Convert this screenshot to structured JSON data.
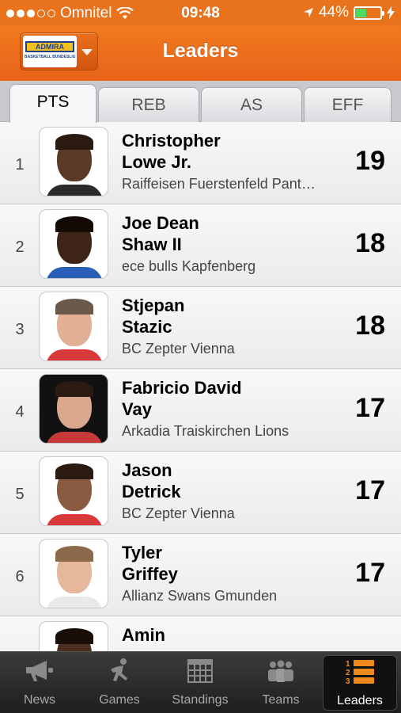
{
  "status": {
    "carrier": "Omnitel",
    "time": "09:48",
    "battery": "44%"
  },
  "header": {
    "title": "Leaders",
    "logo_text": "ADMIRA",
    "logo_sub": "BASKETBALL BUNDESLIGA"
  },
  "tabs": [
    {
      "label": "PTS",
      "active": true
    },
    {
      "label": "REB",
      "active": false
    },
    {
      "label": "AS",
      "active": false
    },
    {
      "label": "EFF",
      "active": false
    }
  ],
  "leaders": [
    {
      "rank": "1",
      "name_line1": "Christopher",
      "name_line2": "Lowe Jr.",
      "team": "Raiffeisen Fuerstenfeld Panthers",
      "value": "19"
    },
    {
      "rank": "2",
      "name_line1": "Joe Dean",
      "name_line2": "Shaw II",
      "team": "ece bulls Kapfenberg",
      "value": "18"
    },
    {
      "rank": "3",
      "name_line1": "Stjepan",
      "name_line2": "Stazic",
      "team": "BC Zepter Vienna",
      "value": "18"
    },
    {
      "rank": "4",
      "name_line1": "Fabricio David",
      "name_line2": "Vay",
      "team": "Arkadia Traiskirchen Lions",
      "value": "17"
    },
    {
      "rank": "5",
      "name_line1": "Jason",
      "name_line2": "Detrick",
      "team": "BC Zepter Vienna",
      "value": "17"
    },
    {
      "rank": "6",
      "name_line1": "Tyler",
      "name_line2": "Griffey",
      "team": "Allianz Swans Gmunden",
      "value": "17"
    },
    {
      "rank": "",
      "name_line1": "Amin",
      "name_line2": "",
      "team": "",
      "value": ""
    }
  ],
  "nav": [
    {
      "label": "News",
      "icon": "megaphone-icon",
      "active": false
    },
    {
      "label": "Games",
      "icon": "runner-icon",
      "active": false
    },
    {
      "label": "Standings",
      "icon": "table-grid-icon",
      "active": false
    },
    {
      "label": "Teams",
      "icon": "team-people-icon",
      "active": false
    },
    {
      "label": "Leaders",
      "icon": "leaders-list-icon",
      "active": true
    }
  ],
  "colors": {
    "accent": "#e8731c",
    "battery_fill": "#4cd964",
    "leaders_icon": "#f08a1c"
  }
}
